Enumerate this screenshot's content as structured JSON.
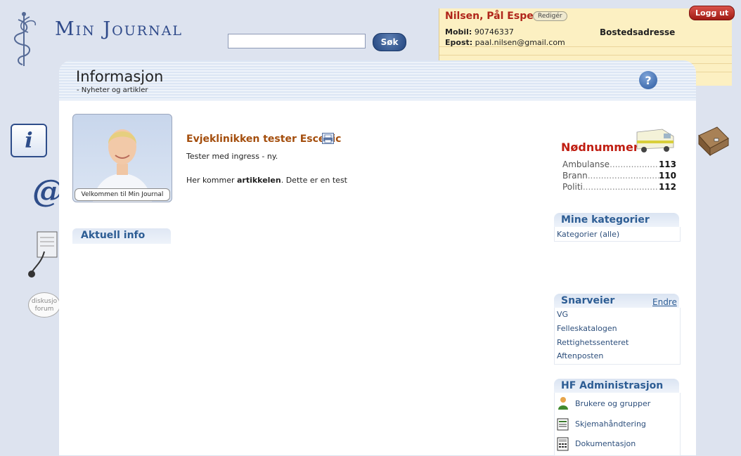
{
  "header": {
    "app_title": "Min Journal",
    "search": {
      "value": "",
      "placeholder": ""
    },
    "search_button": "Søk"
  },
  "user": {
    "name": "Nilsen, Pål Espen",
    "edit_label": "Redigér",
    "mobil_label": "Mobil:",
    "mobil_value": "90746337",
    "epost_label": "Epost:",
    "epost_value": "paal.nilsen@gmail.com",
    "bosted_label": "Bostedsadresse",
    "logout_label": "Logg ut"
  },
  "side_icons": [
    {
      "name": "info-icon",
      "label": "i"
    },
    {
      "name": "email-icon",
      "label": "@"
    },
    {
      "name": "journal-stethoscope-icon",
      "label": ""
    },
    {
      "name": "discussion-forum-icon",
      "label": "diskusjo forum"
    }
  ],
  "panel": {
    "title": "Informasjon",
    "subtitle": "- Nyheter og artikler"
  },
  "welcome": {
    "caption": "Velkommen til Min Journal"
  },
  "aktuell": {
    "title": "Aktuell info"
  },
  "article": {
    "title": "Evjeklinikken tester Escenic",
    "ingress": "Tester med ingress - ny.",
    "body_prefix": "Her kommer ",
    "body_bold": "artikkelen",
    "body_suffix": ". Dette er en test"
  },
  "emergency": {
    "title": "Nødnummer",
    "rows": [
      {
        "label": "Ambulanse",
        "dots": "........................................",
        "number": "113"
      },
      {
        "label": "Brann",
        "dots": ".....................................................",
        "number": "110"
      },
      {
        "label": "Politi",
        "dots": ".....................................................",
        "number": "112"
      }
    ]
  },
  "kategorier": {
    "title": "Mine kategorier",
    "items": [
      "Kategorier (alle)"
    ]
  },
  "snarveier": {
    "title": "Snarveier",
    "edit_label": "Endre",
    "items": [
      "VG",
      "Felleskatalogen",
      "Rettighetssenteret",
      "Aftenposten"
    ]
  },
  "hf_admin": {
    "title": "HF Administrasjon",
    "items": [
      {
        "label": "Brukere og grupper",
        "icon": "users-icon"
      },
      {
        "label": "Skjemahåndtering",
        "icon": "form-icon"
      },
      {
        "label": "Dokumentasjon",
        "icon": "document-icon"
      }
    ]
  },
  "colors": {
    "brand_blue": "#2f4a8a",
    "user_name_red": "#b0251b",
    "article_title_brown": "#a44e0d",
    "box_title_blue": "#2d5d94",
    "emergency_red": "#c01e12",
    "user_panel_bg": "#fcf0c2"
  }
}
